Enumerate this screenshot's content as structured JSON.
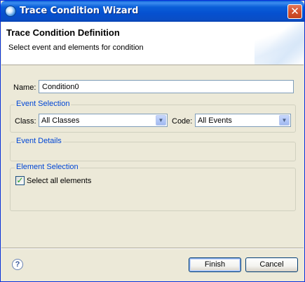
{
  "window": {
    "title": "Trace Condition Wizard",
    "close_glyph": "✕"
  },
  "header": {
    "title": "Trace Condition Definition",
    "description": "Select event and elements for condition"
  },
  "name_field": {
    "label": "Name:",
    "value": "Condition0"
  },
  "event_selection": {
    "legend": "Event Selection",
    "class_label": "Class:",
    "class_value": "All Classes",
    "code_label": "Code:",
    "code_value": "All Events"
  },
  "event_details": {
    "legend": "Event Details"
  },
  "element_selection": {
    "legend": "Element Selection",
    "select_all_label": "Select all elements",
    "select_all_checked": true
  },
  "footer": {
    "help_glyph": "?",
    "finish_label": "Finish",
    "cancel_label": "Cancel"
  },
  "icons": {
    "window": "wizard-app-icon",
    "close": "close-icon",
    "help": "help-icon",
    "dropdown": "chevron-down-icon",
    "check": "checkmark-icon"
  }
}
